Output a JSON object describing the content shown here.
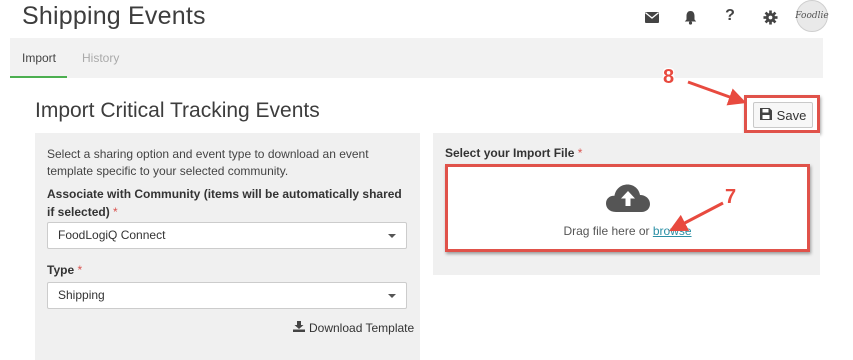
{
  "header": {
    "title": "Shipping Events",
    "icons": [
      "envelope-icon",
      "bell-icon",
      "help-icon",
      "gear-icon"
    ],
    "help_glyph": "?",
    "avatar_text": "Foodlie"
  },
  "tabs": [
    {
      "label": "Import",
      "active": true
    },
    {
      "label": "History",
      "active": false
    }
  ],
  "section": {
    "title": "Import Critical Tracking Events"
  },
  "toolbar": {
    "save_label": "Save"
  },
  "form": {
    "help_text": "Select a sharing option and event type to download an event template specific to your selected community.",
    "community_label": "Associate with Community (items will be automatically shared if selected)",
    "community_value": "FoodLogiQ Connect",
    "type_label": "Type",
    "type_value": "Shipping",
    "required_marker": "*",
    "download_label": "Download Template"
  },
  "import": {
    "label": "Select your Import File",
    "drop_text": "Drag file here or",
    "browse_label": "browse"
  },
  "annotations": {
    "callout_save": "8",
    "callout_drop": "7",
    "color": "#e84a3f"
  },
  "colors": {
    "accent_tab": "#4caf50",
    "link": "#2a8fa5",
    "required": "#d9534f"
  }
}
